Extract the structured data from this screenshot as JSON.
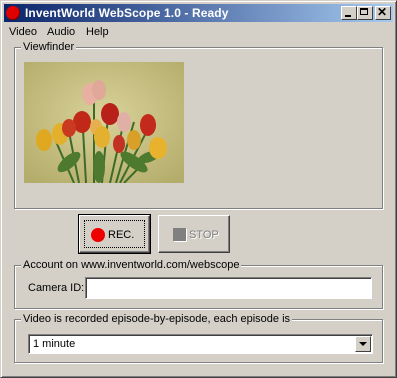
{
  "window": {
    "title": "InventWorld WebScope 1.0 - Ready",
    "icon": "red-circle-icon"
  },
  "menu": [
    "Video",
    "Audio",
    "Help"
  ],
  "viewfinder": {
    "label": "Viewfinder"
  },
  "controls": {
    "rec_label": "REC.",
    "stop_label": "STOP"
  },
  "account": {
    "label": "Account on www.inventworld.com/webscope",
    "camera_id_label": "Camera ID:",
    "camera_id_value": ""
  },
  "episode": {
    "label": "Video is recorded episode-by-episode, each episode is",
    "selected": "1 minute"
  },
  "colors": {
    "titlebar_start": "#0a246a",
    "titlebar_end": "#a6caf0",
    "record_red": "#ee0000"
  }
}
